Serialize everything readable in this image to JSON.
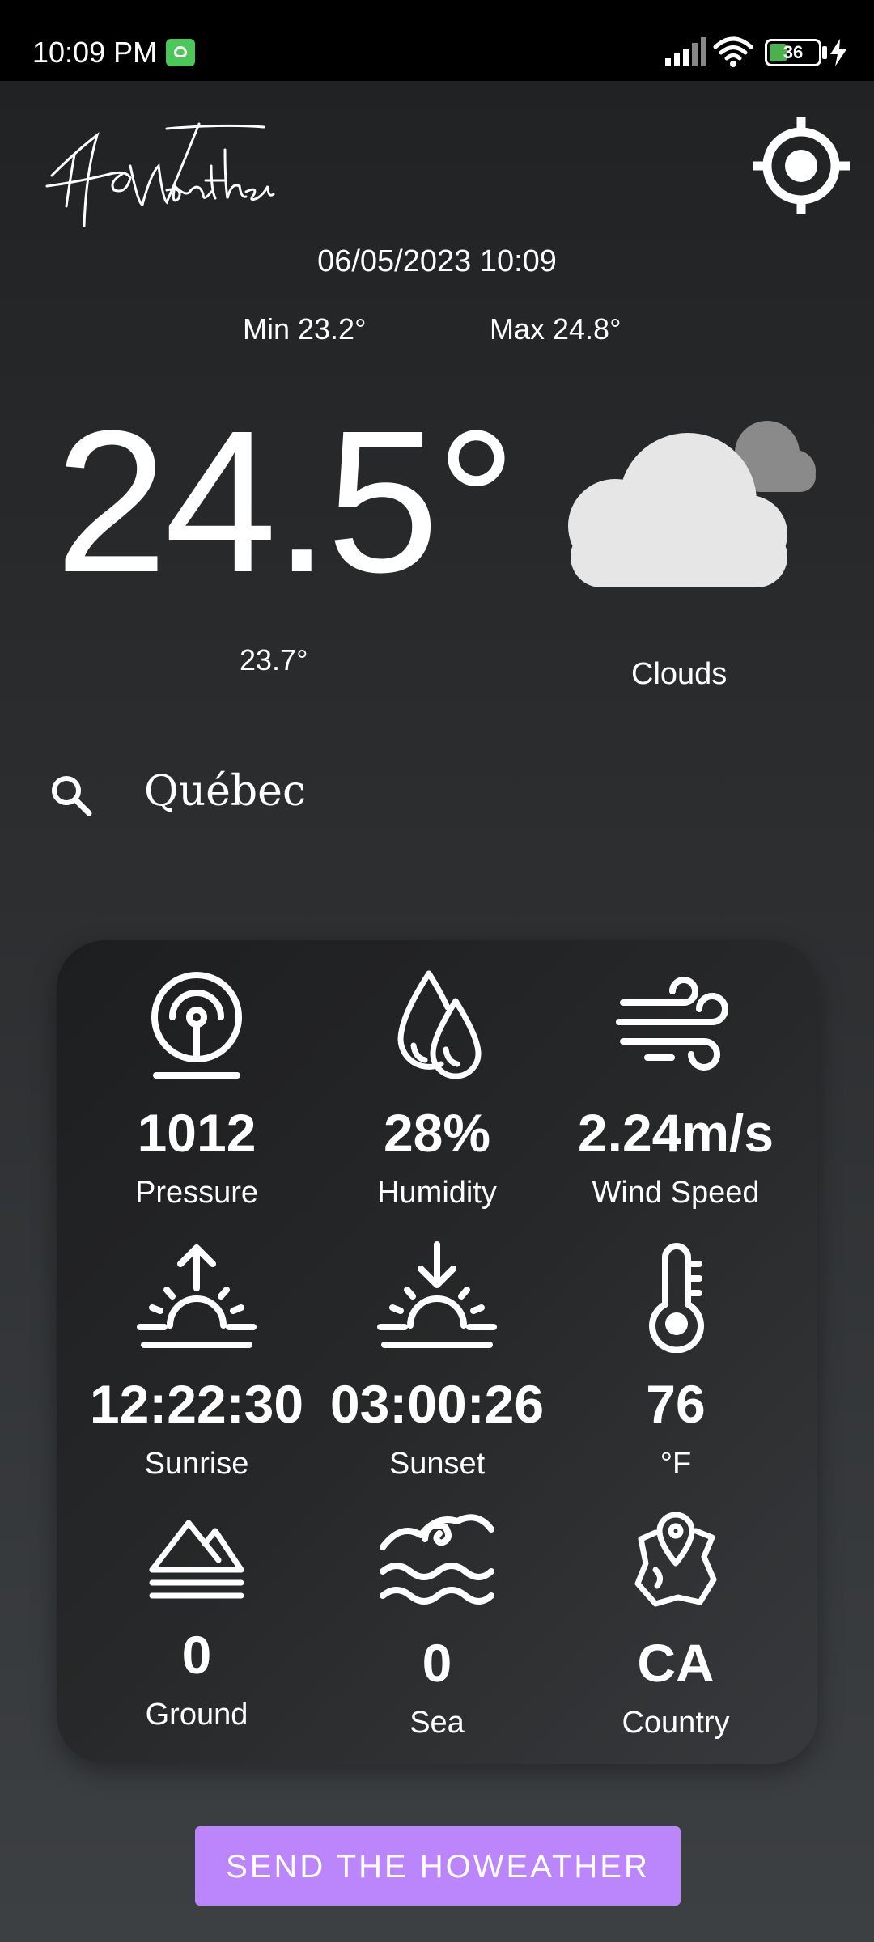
{
  "status_bar": {
    "time": "10:09 PM",
    "battery_level": "36",
    "icons": [
      "app-notification-icon",
      "signal-icon",
      "wifi-icon",
      "battery-icon",
      "charging-bolt-icon"
    ]
  },
  "app": {
    "logo_text": "HoWeather"
  },
  "header": {
    "datetime": "06/05/2023 10:09",
    "min": "Min 23.2°",
    "max": "Max 24.8°"
  },
  "current": {
    "temperature": "24.5°",
    "feels_like": "23.7°",
    "description": "Clouds",
    "icon": "cloud-icon"
  },
  "search": {
    "city": "Québec",
    "icon": "search-icon"
  },
  "details": [
    {
      "value": "1012",
      "label": "Pressure",
      "icon": "pressure-icon"
    },
    {
      "value": "28%",
      "label": "Humidity",
      "icon": "humidity-icon"
    },
    {
      "value": "2.24m/s",
      "label": "Wind Speed",
      "icon": "wind-icon"
    },
    {
      "value": "12:22:30",
      "label": "Sunrise",
      "icon": "sunrise-icon"
    },
    {
      "value": "03:00:26",
      "label": "Sunset",
      "icon": "sunset-icon"
    },
    {
      "value": "76",
      "label": "°F",
      "icon": "thermometer-icon"
    },
    {
      "value": "0",
      "label": "Ground",
      "icon": "ground-level-icon"
    },
    {
      "value": "0",
      "label": "Sea",
      "icon": "sea-level-icon"
    },
    {
      "value": "CA",
      "label": "Country",
      "icon": "map-pin-icon"
    }
  ],
  "actions": {
    "send_label": "SEND THE HOWEATHER"
  },
  "colors": {
    "accent": "#bb86fc",
    "battery": "#4caf50",
    "cloud": "#e6e6e6",
    "cloud_back": "#8a8a8a"
  }
}
